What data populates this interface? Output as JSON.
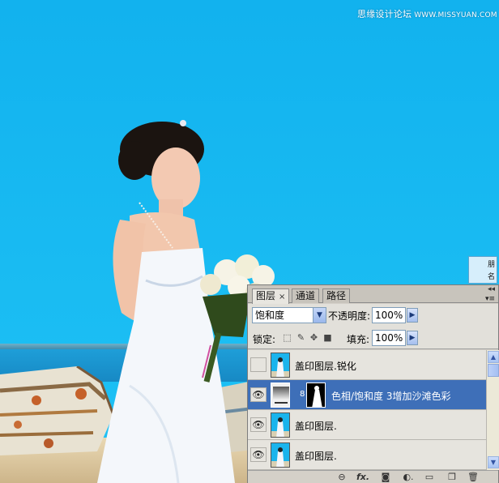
{
  "watermark": {
    "text": "思缘设计论坛",
    "url": "WWW.MISSYUAN.COM"
  },
  "mini_panel": {
    "chars": [
      "朋",
      "名"
    ]
  },
  "layers_panel": {
    "tabs": [
      {
        "label": "图层",
        "close": "×"
      },
      {
        "label": "通道"
      },
      {
        "label": "路径"
      }
    ],
    "collapse_glyph": "◂◂",
    "menu_glyph": "▾≡",
    "blend_mode": "饱和度",
    "opacity_label": "不透明度:",
    "opacity_value": "100%",
    "lock_label": "锁定:",
    "fill_label": "填充:",
    "fill_value": "100%",
    "layers": [
      {
        "name": "盖印图层.锐化",
        "visible": false,
        "selected": false
      },
      {
        "name": "色相/饱和度 3增加沙滩色彩",
        "visible": true,
        "selected": true,
        "has_mask": true
      },
      {
        "name": "盖印图层.",
        "visible": true,
        "selected": false
      },
      {
        "name": "盖印图层.",
        "visible": true,
        "selected": false
      }
    ],
    "footer_buttons": [
      {
        "icon": "link-icon",
        "glyph": "⊖"
      },
      {
        "icon": "fx-icon",
        "glyph": "fx."
      },
      {
        "icon": "mask-icon",
        "glyph": "◙"
      },
      {
        "icon": "adjustment-icon",
        "glyph": "◐."
      },
      {
        "icon": "folder-icon",
        "glyph": "▭"
      },
      {
        "icon": "new-layer-icon",
        "glyph": "❐"
      },
      {
        "icon": "trash-icon",
        "glyph": "🗑"
      }
    ]
  },
  "colors": {
    "sky": "#17b6ee",
    "selected_layer": "#3e6fb8",
    "panel_bg": "#d4d0c8"
  }
}
